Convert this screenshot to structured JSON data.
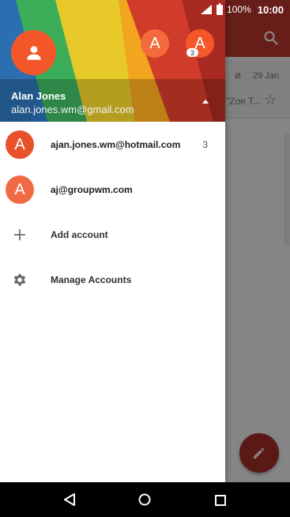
{
  "status_bar": {
    "battery": "100%",
    "time": "10:00"
  },
  "background": {
    "email_date": "29 Jan",
    "email_snippet": "\"Zoe T...",
    "fab_icon": "pencil-icon",
    "search_icon": "search-icon"
  },
  "drawer": {
    "header": {
      "name": "Alan Jones",
      "email": "alan.jones.wm@gmail.com",
      "avatar_icon": "person-icon",
      "account_switcher": [
        {
          "letter": "A"
        },
        {
          "letter": "A",
          "badge": "3"
        }
      ]
    },
    "accounts": [
      {
        "letter": "A",
        "email": "ajan.jones.wm@hotmail.com",
        "count": "3"
      },
      {
        "letter": "A",
        "email": "aj@groupwm.com"
      }
    ],
    "actions": [
      {
        "icon": "plus-icon",
        "label": "Add account"
      },
      {
        "icon": "gear-icon",
        "label": "Manage Accounts"
      }
    ]
  },
  "colors": {
    "accent": "#f4572a",
    "appbar": "#b1342b",
    "navbar": "#000000"
  }
}
